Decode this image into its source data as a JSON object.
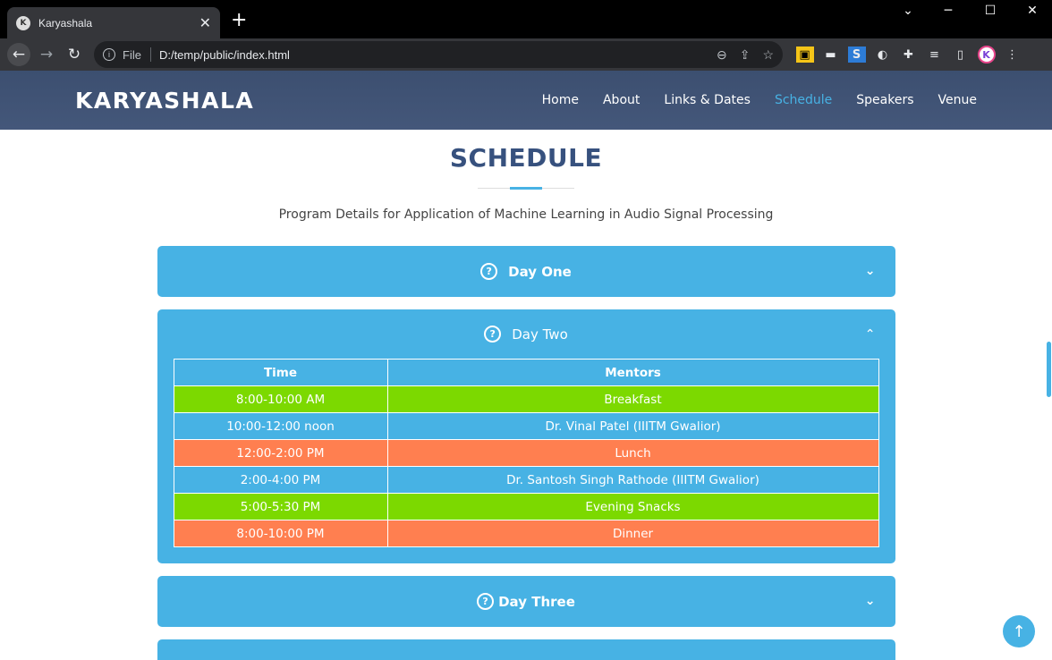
{
  "browser": {
    "tab_title": "Karyashala",
    "tab_favicon": "K",
    "tab_close": "✕",
    "new_tab": "+",
    "win_min": "─",
    "win_max": "☐",
    "win_close": "✕",
    "win_dropdown": "⌄",
    "address_scheme": "File",
    "address_url": "D:/temp/public/index.html",
    "avatar_letter": "K"
  },
  "site": {
    "brand": "KARYASHALA",
    "nav": [
      {
        "label": "Home"
      },
      {
        "label": "About"
      },
      {
        "label": "Links & Dates"
      },
      {
        "label": "Schedule"
      },
      {
        "label": "Speakers"
      },
      {
        "label": "Venue"
      }
    ],
    "active_nav": "Schedule",
    "heading": "SCHEDULE",
    "subtitle": "Program Details for Application of Machine Learning in Audio Signal Processing",
    "accordion": [
      {
        "title": "Day One",
        "expanded": false
      },
      {
        "title": "Day Two",
        "expanded": true
      },
      {
        "title": "Day Three",
        "expanded": false
      }
    ],
    "table": {
      "headers": [
        "Time",
        "Mentors"
      ],
      "rows": [
        {
          "time": "8:00-10:00 AM",
          "mentor": "Breakfast",
          "color": "green"
        },
        {
          "time": "10:00-12:00 noon",
          "mentor": "Dr. Vinal Patel (IIITM Gwalior)",
          "color": "blue"
        },
        {
          "time": "12:00-2:00 PM",
          "mentor": "Lunch",
          "color": "orange"
        },
        {
          "time": "2:00-4:00 PM",
          "mentor": "Dr. Santosh Singh Rathode (IIITM Gwalior)",
          "color": "blue"
        },
        {
          "time": "5:00-5:30 PM",
          "mentor": "Evening Snacks",
          "color": "green"
        },
        {
          "time": "8:00-10:00 PM",
          "mentor": "Dinner",
          "color": "orange"
        }
      ]
    },
    "colors": {
      "accent": "#47b2e4",
      "navbar": "#3c4f70",
      "heading": "#37517e",
      "green_row": "#7cd900",
      "orange_row": "#ff7f50"
    }
  }
}
